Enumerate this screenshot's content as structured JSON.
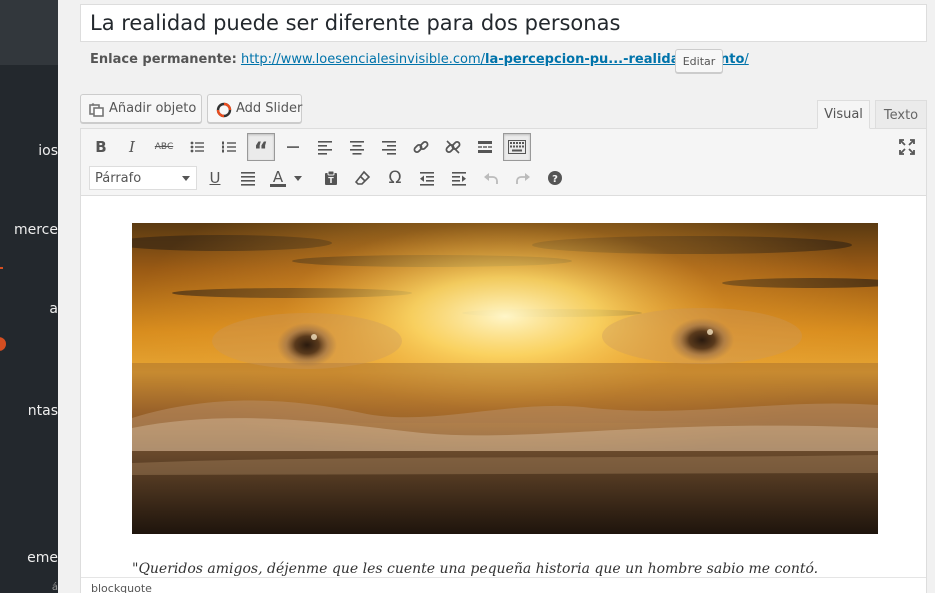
{
  "sidebar": {
    "items": [
      {
        "label": "ios"
      },
      {
        "label": "merce"
      },
      {
        "label": "a"
      },
      {
        "label": "ntas"
      },
      {
        "label": "eme"
      },
      {
        "label": "á"
      }
    ]
  },
  "post": {
    "title": "La realidad puede ser diferente para dos personas"
  },
  "permalink": {
    "label": "Enlace permanente:",
    "base": "http://www.loesencialesinvisible.com/",
    "slug": "la-percepcion-pu...-realidad-cuento",
    "trail": "/",
    "edit_label": "Editar"
  },
  "media": {
    "add_object_label": "Añadir objeto",
    "add_slider_label": "Add Slider"
  },
  "tabs": {
    "visual": "Visual",
    "text": "Texto"
  },
  "toolbar": {
    "format_select": "Párrafo",
    "text_color_letter": "A",
    "accent_color": "#d54e21"
  },
  "content": {
    "quote": "\"Queridos amigos, déjenme que les cuente una pequeña historia que un hombre sabio me contó."
  },
  "status": {
    "path": "blockquote"
  }
}
